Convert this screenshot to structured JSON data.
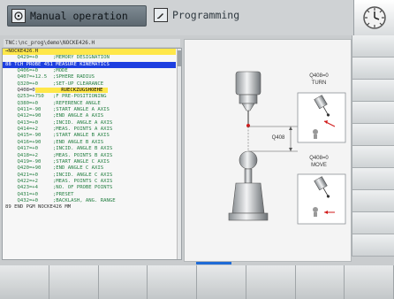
{
  "header": {
    "manual_label": "Manual operation",
    "programming_label": "Programming"
  },
  "file_path": "TNC:\\nc_prog\\demo\\NOCKE426.H",
  "program_lines": [
    {
      "text": "→NOCKE426.H",
      "style": "hl"
    },
    {
      "text": "    Q429=+0     ;MEMORY DESIGNATION",
      "style": ""
    },
    {
      "text": "88 TCH PROBE 451 MEASURE KINEMATICS",
      "style": "blue"
    },
    {
      "text": "    Q406=+0     ;MODE",
      "style": ""
    },
    {
      "text": "    Q407=+12.5  ;SPHERE RADIUS",
      "style": ""
    },
    {
      "text": "    Q320=+0     ;SET-UP CLEARANCE",
      "style": ""
    },
    {
      "text": "    Q408=0",
      "cursor": "       RUECKZUGSHOEHE",
      "style": "dark"
    },
    {
      "text": "    Q253=+750   ;F PRE-POSITIONING",
      "style": ""
    },
    {
      "text": "    Q380=+0     ;REFERENCE ANGLE",
      "style": ""
    },
    {
      "text": "    Q411=-90    ;START ANGLE A AXIS",
      "style": ""
    },
    {
      "text": "    Q412=+90    ;END ANGLE A AXIS",
      "style": ""
    },
    {
      "text": "    Q413=+0     ;INCID. ANGLE A AXIS",
      "style": ""
    },
    {
      "text": "    Q414=+2     ;MEAS. POINTS A AXIS",
      "style": ""
    },
    {
      "text": "    Q415=-90    ;START ANGLE B AXIS",
      "style": ""
    },
    {
      "text": "    Q416=+90    ;END ANGLE B AXIS",
      "style": ""
    },
    {
      "text": "    Q417=+0     ;INCID. ANGLE B AXIS",
      "style": ""
    },
    {
      "text": "    Q418=+2     ;MEAS. POINTS B AXIS",
      "style": ""
    },
    {
      "text": "    Q419=-90    ;START ANGLE C AXIS",
      "style": ""
    },
    {
      "text": "    Q420=+90    ;END ANGLE C AXIS",
      "style": ""
    },
    {
      "text": "    Q421=+0     ;INCID. ANGLE C AXIS",
      "style": ""
    },
    {
      "text": "    Q422=+2     ;MEAS. POINTS C AXIS",
      "style": ""
    },
    {
      "text": "    Q423=+4     ;NO. OF PROBE POINTS",
      "style": ""
    },
    {
      "text": "    Q431=+0     ;PRESET",
      "style": ""
    },
    {
      "text": "    Q432=+0     ;BACKLASH, ANG. RANGE",
      "style": ""
    },
    {
      "text": "89 END PGM NOCKE426 MM",
      "style": "dark"
    }
  ],
  "graphic": {
    "dim_label": "Q408",
    "help_top_title": "Q408=0",
    "help_top_sub": "TURN",
    "help_bottom_title": "Q408=0",
    "help_bottom_sub": "MOVE"
  },
  "colors": {
    "accent_blue": "#1e6bd6",
    "highlight_yellow": "#ffe74a",
    "code_green": "#268043",
    "probe_red": "#d11a1a"
  },
  "icons": {
    "clock": "clock-icon",
    "manual": "hand-wheel-icon",
    "programming": "pencil-icon"
  }
}
